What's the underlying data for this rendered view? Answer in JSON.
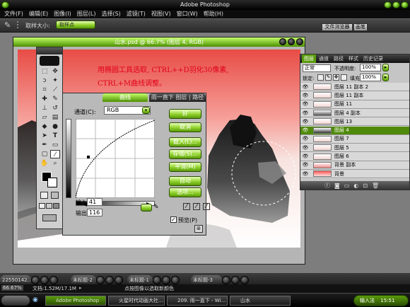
{
  "app_title": "Adobe Photoshop",
  "menu": [
    "文件(F)",
    "编辑(E)",
    "图像(I)",
    "图层(L)",
    "选择(S)",
    "滤镜(T)",
    "视图(V)",
    "窗口(W)",
    "帮助(H)"
  ],
  "options_bar": {
    "label": "取样大小:",
    "value": "取样点",
    "tabs": [
      "文件浏览器",
      "画笔"
    ]
  },
  "document": {
    "title": "山水.psd @ 66.7% (图层 4, RGB)"
  },
  "annotation": {
    "line1": "用椭圆工具选取, CTRL++D羽化30像素,",
    "line2": "CTRL+M曲线调整。"
  },
  "curves": {
    "tabs": [
      "曲线",
      "雨一直下 图层 | 路径"
    ],
    "channel_label": "通道(C):",
    "channel_value": "RGB",
    "input_label": "输入:",
    "input_value": "41",
    "output_label": "输出:",
    "output_value": "116",
    "buttons": [
      "好",
      "取消",
      "载入(L)...",
      "存储(S)...",
      "平滑(M)",
      "自动",
      "选项..."
    ],
    "preview_label": "预览(P)"
  },
  "layers": {
    "tabs": [
      "图层",
      "通道",
      "路径",
      "样式",
      "历史记录"
    ],
    "blend_mode": "正常",
    "opacity_label": "不透明度:",
    "opacity_value": "100%",
    "lock_label": "锁定:",
    "fill_label": "填充:",
    "fill_value": "100%",
    "items": [
      "图层 11 副本 2",
      "图层 11 副本",
      "图层 11",
      "图层 4 副本",
      "图层 13",
      "图层 4",
      "图层 7",
      "图层 5",
      "图层 6",
      "背景 副本",
      "背景"
    ],
    "selected_index": 5
  },
  "bottom_tabs": [
    "22550142...",
    "未标题-2",
    "未标题-1",
    "未标题-3"
  ],
  "status": {
    "zoom": "66.67%",
    "doc_size": "文档:1.52M/17.1M",
    "hint": "点按图像以选取新颜色"
  },
  "taskbar": {
    "items": [
      "Adobe Photoshop",
      "火星时代动画大社...",
      "209. 雨一直下 - Wi...",
      "山水"
    ],
    "clock": "15:51",
    "tray_label": "输入法"
  },
  "colors": {
    "accent_green": "#5a9c0c",
    "selection_green": "#4f8a0a"
  }
}
